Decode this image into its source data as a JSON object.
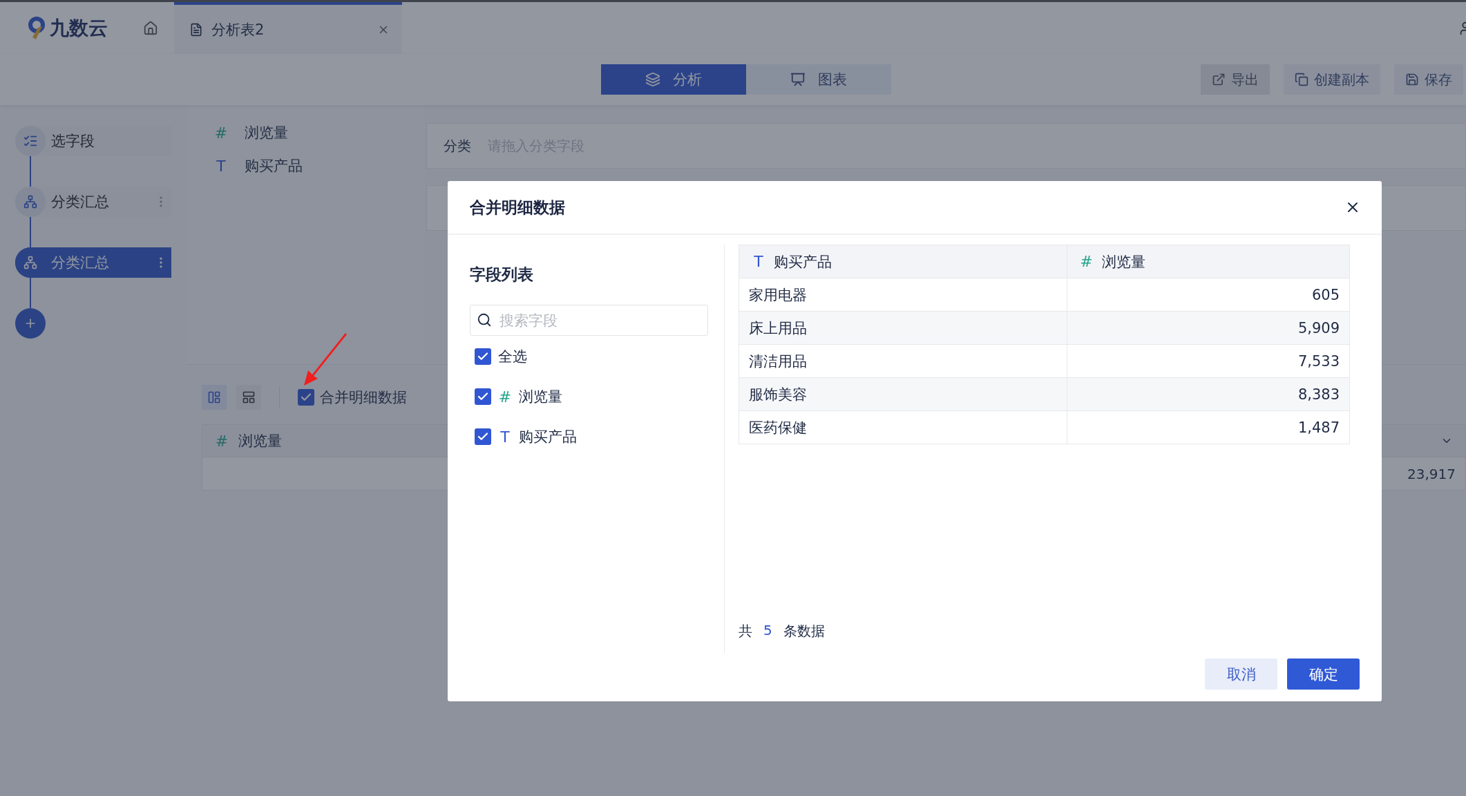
{
  "header": {
    "logo": "九数云",
    "tabs": [
      {
        "label": "分析表2",
        "selected": true
      }
    ]
  },
  "toolbar": {
    "modes": [
      {
        "label": "分析",
        "kind": "analysis",
        "selected": true
      },
      {
        "label": "图表",
        "kind": "chart",
        "selected": false
      }
    ],
    "actions": [
      {
        "label": "导出",
        "kind": "export",
        "disabled": true
      },
      {
        "label": "创建副本",
        "kind": "copy",
        "disabled": false
      },
      {
        "label": "保存",
        "kind": "save",
        "disabled": false
      }
    ]
  },
  "steps": [
    {
      "label": "选字段",
      "kind": "fields",
      "selected": false,
      "menu": false
    },
    {
      "label": "分类汇总",
      "kind": "group",
      "selected": false,
      "menu": true
    },
    {
      "label": "分类汇总",
      "kind": "group",
      "selected": true,
      "menu": true
    }
  ],
  "fields": [
    {
      "icon": "#",
      "kind": "number",
      "name": "浏览量"
    },
    {
      "icon": "T",
      "kind": "text",
      "name": "购买产品"
    }
  ],
  "category": {
    "label": "分类",
    "placeholder": "请拖入分类字段"
  },
  "merge_detail": {
    "label": "合并明细数据",
    "checked": true
  },
  "result": {
    "icon": "#",
    "column": "浏览量",
    "total": "23,917"
  },
  "dialog": {
    "title": "合并明细数据",
    "field_list": {
      "title": "字段列表",
      "search_placeholder": "搜索字段",
      "select_all": {
        "label": "全选",
        "checked": true
      },
      "items": [
        {
          "icon": "#",
          "kind": "number",
          "name": "浏览量",
          "checked": true
        },
        {
          "icon": "T",
          "kind": "text",
          "name": "购买产品",
          "checked": true
        }
      ]
    },
    "table": {
      "columns": [
        {
          "icon": "T",
          "kind": "text",
          "name": "购买产品"
        },
        {
          "icon": "#",
          "kind": "number",
          "name": "浏览量"
        }
      ],
      "rows": [
        [
          "家用电器",
          "605"
        ],
        [
          "床上用品",
          "5,909"
        ],
        [
          "清洁用品",
          "7,533"
        ],
        [
          "服饰美容",
          "8,383"
        ],
        [
          "医药保健",
          "1,487"
        ]
      ]
    },
    "count": {
      "prefix": "共",
      "value": "5",
      "suffix": "条数据"
    },
    "buttons": [
      {
        "label": "取消",
        "kind": "secondary"
      },
      {
        "label": "确定",
        "kind": "primary"
      }
    ]
  }
}
